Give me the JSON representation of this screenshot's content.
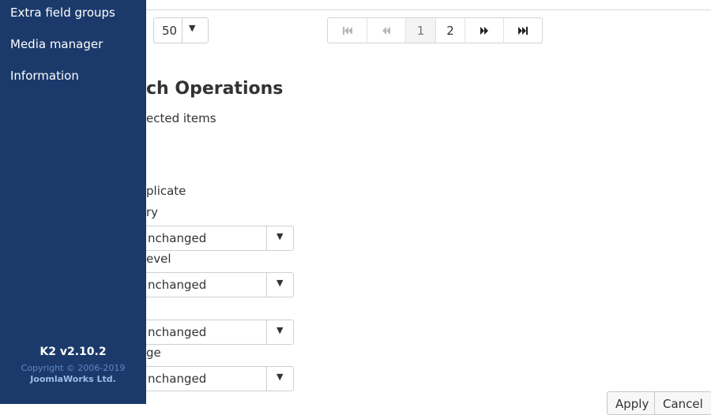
{
  "sidebar": {
    "items": [
      {
        "label": "Extra field groups"
      },
      {
        "label": "Media manager"
      },
      {
        "label": "Information"
      }
    ],
    "footer": {
      "version": "K2 v2.10.2",
      "copyright": "Copyright © 2006-2019",
      "company": "JoomlaWorks Ltd."
    },
    "background_color": "#1b3a6b"
  },
  "list_limit": {
    "value": "50"
  },
  "pagination": {
    "first_icon": "skip-first-icon",
    "prev_icon": "rewind-icon",
    "pages": [
      "1",
      "2"
    ],
    "current_page": "1",
    "next_icon": "fast-forward-icon",
    "last_icon": "skip-last-icon"
  },
  "batch": {
    "heading": "ch Operations",
    "subtext": "ected items",
    "labels": {
      "duplicate": "plicate",
      "category": "ry",
      "access": "evel",
      "language": "ge"
    },
    "selects": [
      {
        "value": "nchanged"
      },
      {
        "value": "nchanged"
      },
      {
        "value": "nchanged"
      },
      {
        "value": "nchanged"
      }
    ]
  },
  "actions": {
    "apply": "Apply",
    "cancel": "Cancel"
  }
}
